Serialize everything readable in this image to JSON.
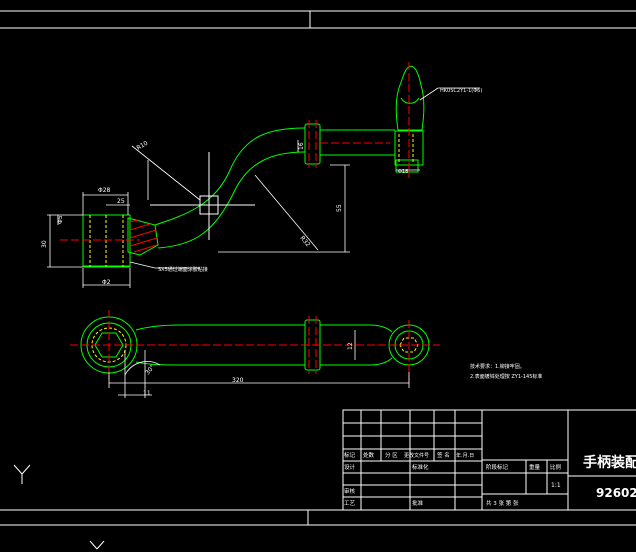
{
  "drawing": {
    "title": "手柄装配图",
    "number": "92602",
    "scale": "1:1",
    "sheet_text": "共 3 张  第 张"
  },
  "title_block": {
    "row_labels": [
      "标记",
      "处数",
      "分 区",
      "更改文件号",
      "签 名",
      "年.月.日"
    ],
    "designer": "设计",
    "standardization": "标准化",
    "stage_mark": "阶段标记",
    "weight": "重量",
    "scale_label": "比例",
    "reviewer": "审核",
    "process": "工艺",
    "approve": "批准"
  },
  "dimensions": {
    "d1": "R10",
    "d2": "Φ28",
    "d3": "25",
    "d4": "Φ5",
    "d5": "30",
    "d6": "Φ2",
    "d7": "55",
    "d8": "R32",
    "d9": "16",
    "d10": "320",
    "d11": "30°",
    "d12": "11",
    "d13": "12",
    "d14": "26",
    "d15": "Φ18"
  },
  "callouts": {
    "handle_part": "HK05C2Y1-1(Φ6)",
    "boss_note": "SX5通过端面涂胶粘接",
    "side_note": "M5×8螺钉"
  },
  "tech_req": {
    "line1": "技术要求：1.铆接牢固。",
    "line2": "2.表面镀锌处理按 ZY1-145标准"
  },
  "colors": {
    "outline": "#00ff00",
    "center": "#ff0000",
    "hidden": "#ffff00",
    "frame": "#ffffff",
    "hatch": "#ff0000"
  },
  "ucs": {
    "axis_y": "Y"
  }
}
